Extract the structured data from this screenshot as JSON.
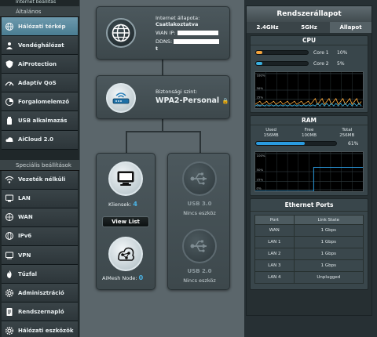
{
  "sidebar": {
    "top_cut_label": "Internet beállítás",
    "general_header": "Általános",
    "general_items": [
      {
        "label": "Hálózati térkép",
        "icon": "network-map-icon",
        "active": true
      },
      {
        "label": "Vendéghálózat",
        "icon": "guest-network-icon"
      },
      {
        "label": "AiProtection",
        "icon": "aiprotection-icon"
      },
      {
        "label": "Adaptív QoS",
        "icon": "qos-icon"
      },
      {
        "label": "Forgalomelemző",
        "icon": "traffic-analyzer-icon"
      },
      {
        "label": "USB alkalmazás",
        "icon": "usb-app-icon"
      },
      {
        "label": "AiCloud 2.0",
        "icon": "aicloud-icon"
      }
    ],
    "advanced_header": "Speciális beállítások",
    "advanced_items": [
      {
        "label": "Vezeték nélküli",
        "icon": "wireless-icon"
      },
      {
        "label": "LAN",
        "icon": "lan-icon"
      },
      {
        "label": "WAN",
        "icon": "wan-icon"
      },
      {
        "label": "IPv6",
        "icon": "ipv6-icon"
      },
      {
        "label": "VPN",
        "icon": "vpn-icon"
      },
      {
        "label": "Tűzfal",
        "icon": "firewall-icon"
      },
      {
        "label": "Adminisztráció",
        "icon": "admin-icon"
      },
      {
        "label": "Rendszernapló",
        "icon": "system-log-icon"
      },
      {
        "label": "Hálózati eszközök",
        "icon": "network-tools-icon"
      }
    ]
  },
  "map": {
    "internet": {
      "status_label": "Internet állapota:",
      "status_value": "Csatlakoztatva",
      "wan_ip_label": "WAN IP:",
      "ddns_label": "DDNS:",
      "ddns_tail": "t"
    },
    "security": {
      "label": "Biztonsági szint:",
      "value": "WPA2-Personal"
    },
    "clients": {
      "label": "Kliensek:",
      "count": "4",
      "view_list": "View List"
    },
    "aimesh": {
      "label": "AiMesh Node:",
      "count": "0"
    },
    "usb30": {
      "title": "USB 3.0",
      "status": "Nincs eszköz"
    },
    "usb20": {
      "title": "USB 2.0",
      "status": "Nincs eszköz"
    }
  },
  "status_panel": {
    "title": "Rendszerállapot",
    "tabs": [
      {
        "label": "2.4GHz",
        "active": false
      },
      {
        "label": "5GHz",
        "active": false
      },
      {
        "label": "Állapot",
        "active": true
      }
    ],
    "cpu": {
      "title": "CPU",
      "cores": [
        {
          "label": "Core 1",
          "value": "10%",
          "fraction": 0.1,
          "color": "#f2a33c"
        },
        {
          "label": "Core 2",
          "value": "5%",
          "fraction": 0.05,
          "color": "#39b0e0"
        }
      ],
      "graph_ticks": [
        "100%",
        "50%",
        "25%",
        "0%"
      ]
    },
    "ram": {
      "title": "RAM",
      "used_label": "Used",
      "used_value": "156MB",
      "free_label": "Free",
      "free_value": "100MB",
      "total_label": "Total",
      "total_value": "256MB",
      "percent": "61%",
      "fraction": 0.61,
      "color": "#2a9be0",
      "graph_ticks": [
        "100%",
        "50%",
        "25%",
        "0%"
      ]
    },
    "ethernet": {
      "title": "Ethernet Ports",
      "headers": [
        "Port",
        "Link State"
      ],
      "rows": [
        {
          "port": "WAN",
          "state": "1 Gbps"
        },
        {
          "port": "LAN 1",
          "state": "1 Gbps"
        },
        {
          "port": "LAN 2",
          "state": "1 Gbps"
        },
        {
          "port": "LAN 3",
          "state": "1 Gbps"
        },
        {
          "port": "LAN 4",
          "state": "Unplugged"
        }
      ]
    }
  }
}
